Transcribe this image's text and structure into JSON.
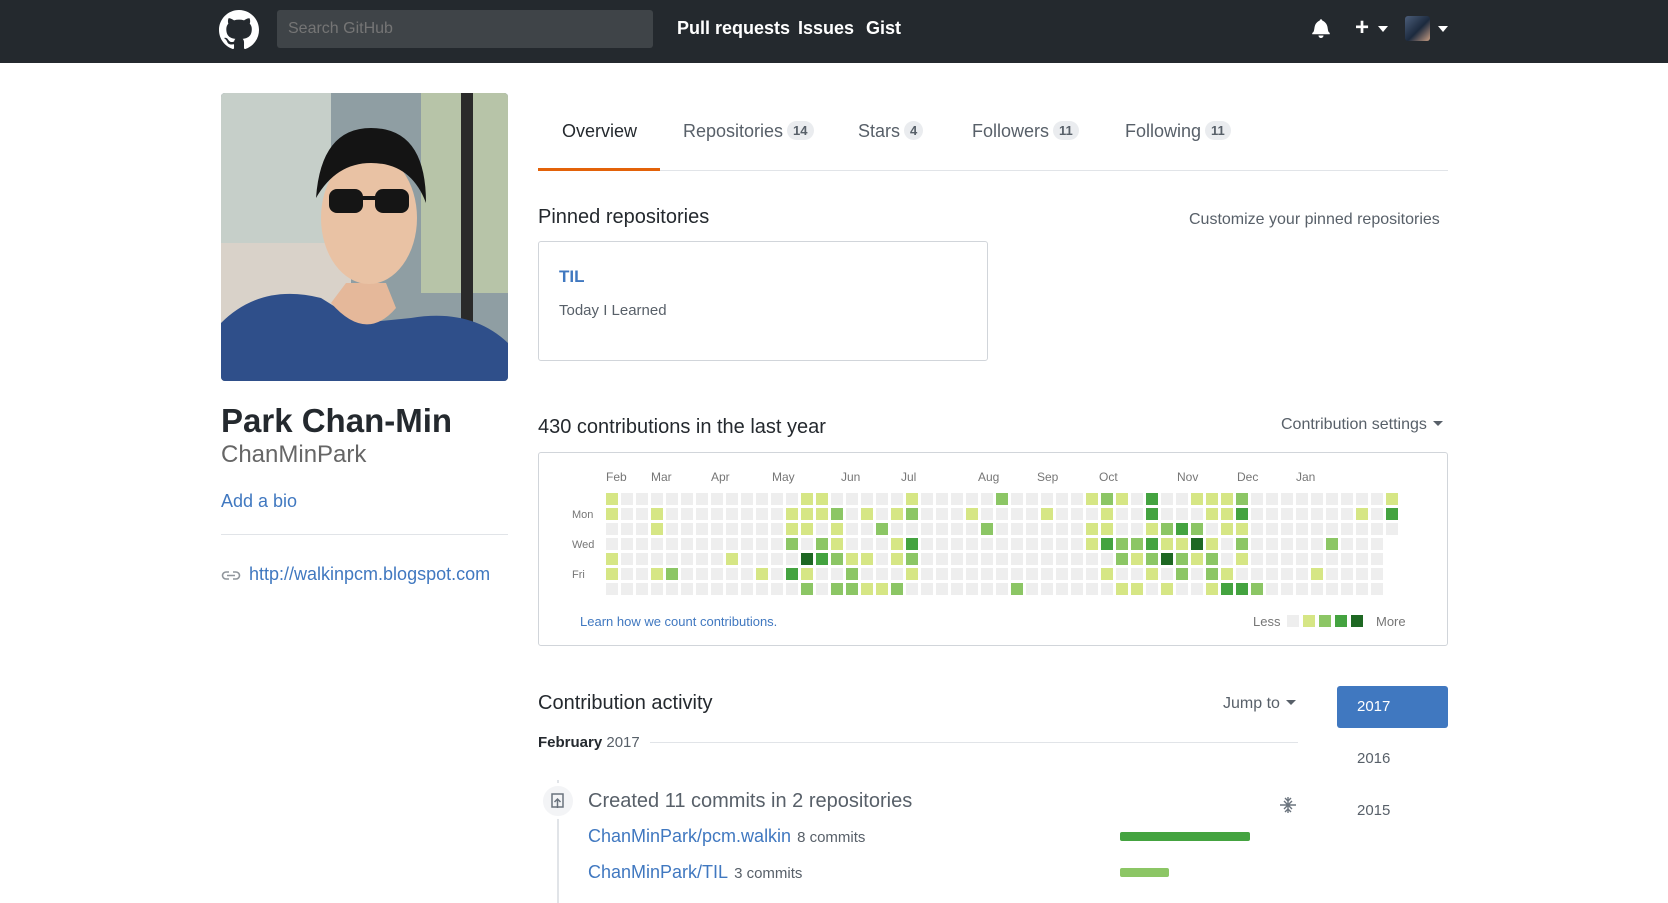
{
  "header": {
    "search_placeholder": "Search GitHub",
    "nav": [
      "Pull requests",
      "Issues",
      "Gist"
    ]
  },
  "profile": {
    "name": "Park Chan-Min",
    "login": "ChanMinPark",
    "bio_link": "Add a bio",
    "website": "http://walkinpcm.blogspot.com"
  },
  "tabs": [
    {
      "label": "Overview",
      "count": ""
    },
    {
      "label": "Repositories",
      "count": "14"
    },
    {
      "label": "Stars",
      "count": "4"
    },
    {
      "label": "Followers",
      "count": "11"
    },
    {
      "label": "Following",
      "count": "11"
    }
  ],
  "pinned": {
    "title": "Pinned repositories",
    "customize": "Customize your pinned repositories",
    "repo_name": "TIL",
    "repo_desc": "Today I Learned"
  },
  "contributions": {
    "title": "430 contributions in the last year",
    "settings": "Contribution settings",
    "months": [
      "Feb",
      "Mar",
      "Apr",
      "May",
      "Jun",
      "Jul",
      "Aug",
      "Sep",
      "Oct",
      "Nov",
      "Dec",
      "Jan"
    ],
    "days": [
      "Mon",
      "Wed",
      "Fri"
    ],
    "learn": "Learn how we count contributions.",
    "less": "Less",
    "more": "More",
    "colors": [
      "#eeeeee",
      "#d6e685",
      "#8cc665",
      "#44a340",
      "#1e6823"
    ]
  },
  "activity": {
    "title": "Contribution activity",
    "jump": "Jump to",
    "month": "February",
    "month_year": "2017",
    "commit_title": "Created 11 commits in 2 repositories",
    "repos": [
      {
        "name": "ChanMinPark/pcm.walkin",
        "commits": "8 commits",
        "count": 8
      },
      {
        "name": "ChanMinPark/TIL",
        "commits": "3 commits",
        "count": 3
      }
    ],
    "years": [
      "2017",
      "2016",
      "2015"
    ]
  }
}
